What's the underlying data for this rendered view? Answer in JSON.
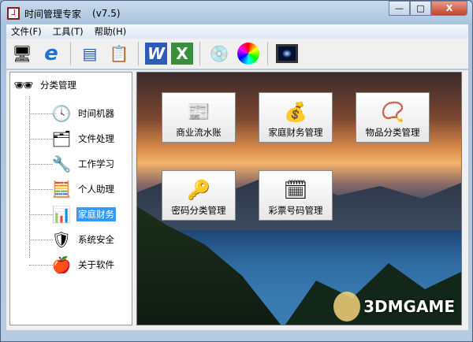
{
  "window": {
    "title": "时间管理专家",
    "version": "(v7.5)",
    "controls": [
      "—",
      "□",
      "X"
    ]
  },
  "menu": [
    "文件(F)",
    "工具(T)",
    "帮助(H)"
  ],
  "toolbar": [
    {
      "name": "computer",
      "glyph": "🖥"
    },
    {
      "name": "internet-explorer",
      "glyph": "e"
    },
    {
      "name": "web-pages",
      "glyph": "▤"
    },
    {
      "name": "clipboard",
      "glyph": "📋"
    },
    {
      "name": "word",
      "glyph": "W"
    },
    {
      "name": "excel",
      "glyph": "X"
    },
    {
      "name": "cd",
      "glyph": "💿"
    },
    {
      "name": "color-wheel",
      "glyph": "◉"
    },
    {
      "name": "monitor",
      "glyph": "🖵"
    }
  ],
  "tree": {
    "root": "分类管理",
    "items": [
      {
        "label": "时间机器",
        "glyph": "🕓"
      },
      {
        "label": "文件处理",
        "glyph": "🗂"
      },
      {
        "label": "工作学习",
        "glyph": "🔧"
      },
      {
        "label": "个人助理",
        "glyph": "🧮"
      },
      {
        "label": "家庭财务",
        "glyph": "📊",
        "selected": true
      },
      {
        "label": "系统安全",
        "glyph": "🛡"
      },
      {
        "label": "关于软件",
        "glyph": "🍎"
      }
    ]
  },
  "buttons": [
    {
      "label": "商业流水账",
      "glyph": "📰"
    },
    {
      "label": "家庭财务管理",
      "glyph": "💰"
    },
    {
      "label": "物品分类管理",
      "glyph": "📿"
    },
    {
      "label": "密码分类管理",
      "glyph": "🔑"
    },
    {
      "label": "彩票号码管理",
      "glyph": "🗓"
    }
  ],
  "watermark": "3DMGAME"
}
